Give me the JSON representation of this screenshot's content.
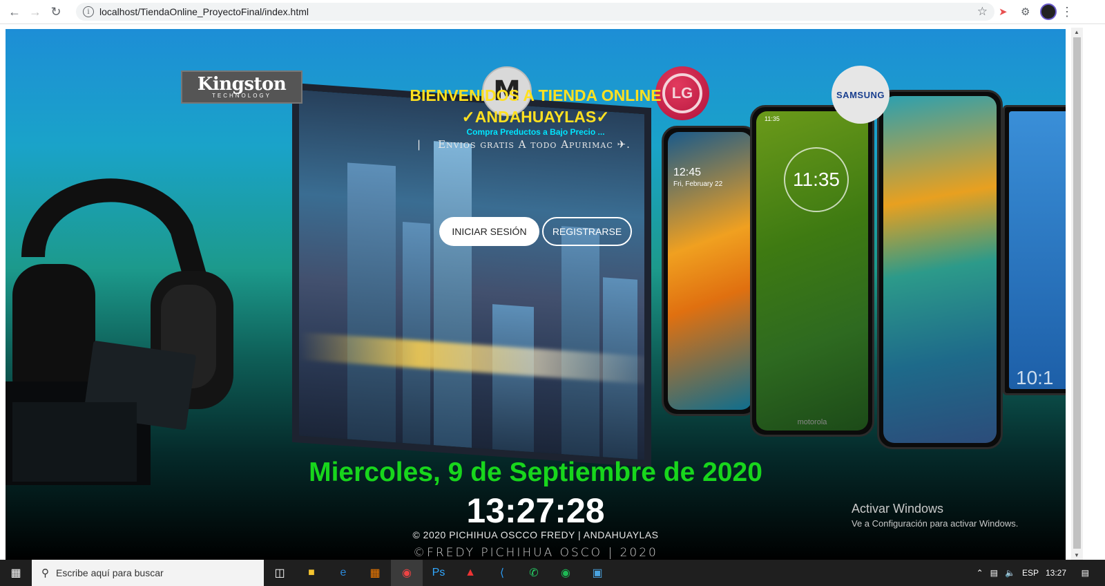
{
  "browser": {
    "url": "localhost/TiendaOnline_ProyectoFinal/index.html"
  },
  "brands": {
    "kingston_main": "Kingston",
    "kingston_sub": "TECHNOLOGY",
    "motorola": "M",
    "lg": "LG",
    "samsung": "SAMSUNG"
  },
  "hero": {
    "title_line1": "BIENVENIDOS A TIENDA ONLINE",
    "title_line2": "✓ANDAHUAYLAS✓",
    "subtitle": "Compra Preductos a Bajo Precio ...",
    "typing_cursor": "|",
    "typing_text": "Envios gratis A todo Apurimac ✈."
  },
  "buttons": {
    "login": "INICIAR SESIÓN",
    "register": "REGISTRARSE"
  },
  "footer": {
    "date": "Miercoles, 9 de Septiembre de 2020",
    "time": "13:27:28",
    "copyright": "© 2020 PICHIHUA OSCCO FREDY | ANDAHUAYLAS",
    "signature": "©FREDY  PICHIHUA  OSCO    | 2020"
  },
  "phones": {
    "samsung_time": "12:45",
    "samsung_date": "Fri, February 22",
    "moto_status_time": "11:35",
    "moto_clock": "11:35",
    "moto_brand": "motorola",
    "last_phone_time": "10:1"
  },
  "windows_watermark": {
    "line1": "Activar Windows",
    "line2": "Ve a Configuración para activar Windows."
  },
  "taskbar": {
    "search_placeholder": "Escribe aquí para buscar",
    "language": "ESP",
    "clock": "13:27"
  }
}
